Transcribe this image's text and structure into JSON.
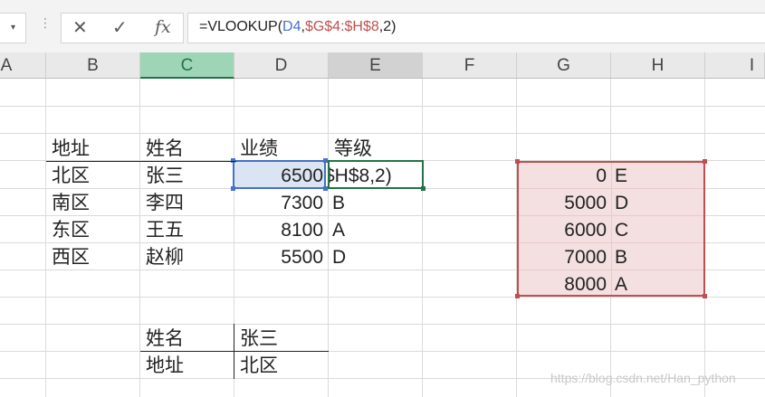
{
  "formula_bar": {
    "namebox_arrow": "▾",
    "dots": "⋮",
    "cancel": "✕",
    "enter": "✓",
    "fx": "fx",
    "formula_prefix": "=VLOOKUP(",
    "arg1": "D4",
    "sep1": ",",
    "arg2": "$G$4:$H$8",
    "suffix": ",2)"
  },
  "columns": [
    "A",
    "B",
    "C",
    "D",
    "E",
    "F",
    "G",
    "H",
    "I"
  ],
  "table": {
    "headers": [
      "地址",
      "姓名",
      "业绩",
      "等级"
    ],
    "rows": [
      {
        "addr": "北区",
        "name": "张三",
        "perf": "6500",
        "grade": "$H$8,2)"
      },
      {
        "addr": "南区",
        "name": "李四",
        "perf": "7300",
        "grade": "B"
      },
      {
        "addr": "东区",
        "name": "王五",
        "perf": "8100",
        "grade": "A"
      },
      {
        "addr": "西区",
        "name": "赵柳",
        "perf": "5500",
        "grade": "D"
      }
    ]
  },
  "lookup": [
    {
      "score": "0",
      "grade": "E"
    },
    {
      "score": "5000",
      "grade": "D"
    },
    {
      "score": "6000",
      "grade": "C"
    },
    {
      "score": "7000",
      "grade": "B"
    },
    {
      "score": "8000",
      "grade": "A"
    }
  ],
  "query": {
    "label1": "姓名",
    "value1": "张三",
    "label2": "地址",
    "value2": "北区"
  },
  "watermark": "https://blog.csdn.net/Han_python",
  "colors": {
    "accent_green": "#217346",
    "ref_blue": "#4472c4",
    "ref_red": "#c0504d"
  }
}
